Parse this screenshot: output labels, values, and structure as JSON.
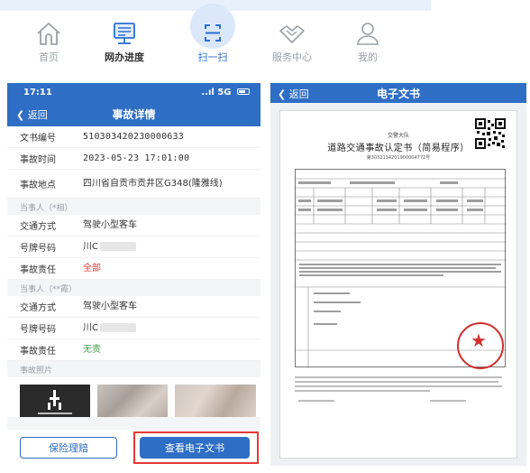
{
  "tabbar": {
    "tabs": [
      {
        "label": "首页",
        "icon": "home-icon"
      },
      {
        "label": "网办进度",
        "icon": "monitor-icon"
      },
      {
        "label": "扫一扫",
        "icon": "scan-icon"
      },
      {
        "label": "服务中心",
        "icon": "handshake-icon"
      },
      {
        "label": "我的",
        "icon": "user-icon"
      }
    ]
  },
  "detail_screen": {
    "status_time": "17:11",
    "status_signal": "..ıl 5G",
    "back_label": "返回",
    "title": "事故详情",
    "rows_top": [
      {
        "label": "文书编号",
        "value": "510303420230000633"
      },
      {
        "label": "事故时间",
        "value": "2023-05-23 17:01:00"
      },
      {
        "label": "事故地点",
        "value": "四川省自贡市贡井区G348(隆雅线)"
      }
    ],
    "party1_header": "当事人（*相）",
    "party1": [
      {
        "label": "交通方式",
        "value": "驾驶小型客车"
      },
      {
        "label": "号牌号码",
        "value": "川C"
      },
      {
        "label": "事故责任",
        "value": "全部"
      }
    ],
    "party2_header": "当事人（**霞）",
    "party2": [
      {
        "label": "交通方式",
        "value": "驾驶小型客车"
      },
      {
        "label": "号牌号码",
        "value": "川C"
      },
      {
        "label": "事故责任",
        "value": "无责"
      }
    ],
    "photos_header": "事故照片",
    "insurance_button": "保险理赔",
    "view_doc_button": "查看电子文书"
  },
  "doc_screen": {
    "back_label": "返回",
    "title": "电子文书",
    "doc_org": "交警大队",
    "doc_title": "道路交通事故认定书（简易程序）",
    "doc_number": "第3032134201900004772号"
  },
  "colors": {
    "brand_blue": "#2f6ec5",
    "highlight_red": "#e53935",
    "responsibility_full": "#e53935",
    "responsibility_none": "#43a047"
  }
}
